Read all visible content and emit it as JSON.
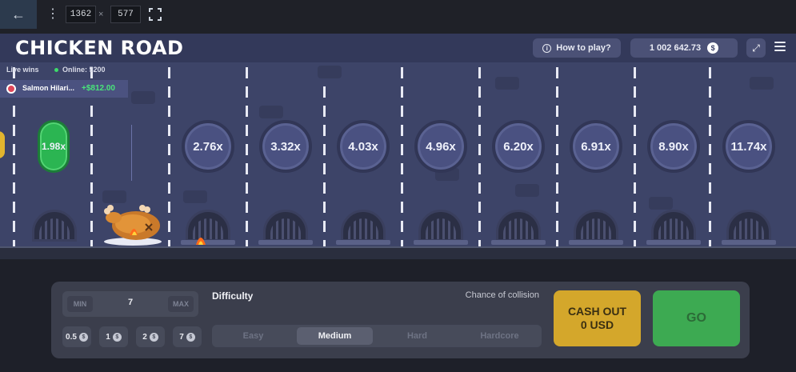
{
  "devtools": {
    "back_icon": "arrow-left-icon",
    "more_icon": "vertical-dots-icon",
    "width": "1362",
    "times": "×",
    "height": "577",
    "fullscreen_icon": "fullscreen-icon"
  },
  "header": {
    "logo": "CHICKEN ROAD",
    "how_to_play": "How to play?",
    "balance": "1 002 642.73",
    "currency_symbol": "$",
    "expand_icon": "expand-icon",
    "menu_icon": "hamburger-menu-icon"
  },
  "live": {
    "title": "Live wins",
    "online_label": "Online: 5200",
    "latest": {
      "name": "Salmon Hilari...",
      "amount": "+$812.00"
    }
  },
  "multipliers": [
    "1.98x",
    "2.76x",
    "3.32x",
    "4.03x",
    "4.96x",
    "6.20x",
    "6.91x",
    "8.90x",
    "11.74x"
  ],
  "controls": {
    "min_label": "MIN",
    "bet_value": "7",
    "max_label": "MAX",
    "chips": [
      "0.5",
      "1",
      "2",
      "7"
    ],
    "difficulty_label": "Difficulty",
    "chance_label": "Chance of collision",
    "difficulty_options": [
      "Easy",
      "Medium",
      "Hard",
      "Hardcore"
    ],
    "selected_difficulty": "Medium",
    "cashout_line1": "CASH OUT",
    "cashout_line2": "0 USD",
    "go_label": "GO"
  },
  "colors": {
    "road": "#3d4468",
    "cashout": "#d4a72b",
    "go": "#3daa52",
    "current_multiplier": "#2bb552"
  }
}
